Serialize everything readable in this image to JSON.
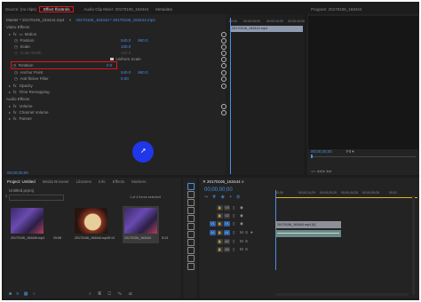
{
  "top_tabs": {
    "source": "Source: (no clips)",
    "effect_controls": "Effect Controls",
    "audio_mixer": "Audio Clip Mixer: 20170106_163444",
    "metadata": "Metadata"
  },
  "effect_controls": {
    "master": "Master * 20170106_163444.mp4",
    "sequence_clip": "20170106_163444 * 20170106_163444.mp4",
    "ruler_ticks": [
      "00:00",
      "00:00:05:00",
      "00:00:10:00",
      "00:00:15:00"
    ],
    "clip_bar_label": "20170106_163444.mp4",
    "video_effects_label": "Video Effects",
    "motion_label": "Motion",
    "position_label": "Position",
    "position_x": "540.0",
    "position_y": "960.0",
    "scale_label": "Scale",
    "scale_value": "100.0",
    "scale_width_label": "Scale Width",
    "scale_width_value": "100.0",
    "uniform_scale_label": "Uniform Scale",
    "rotation_label": "Rotation",
    "rotation_value": "0.0",
    "anchor_label": "Anchor Point",
    "anchor_x": "540.0",
    "anchor_y": "960.0",
    "antiflicker_label": "Anti-flicker Filter",
    "antiflicker_value": "0.00",
    "opacity_label": "Opacity",
    "time_remap_label": "Time Remapping",
    "audio_effects_label": "Audio Effects",
    "volume_label": "Volume",
    "channel_volume_label": "Channel Volume",
    "panner_label": "Panner",
    "timecode": "00;00;00;00"
  },
  "program": {
    "title": "Program: 20170106_163444",
    "timecode": "00;00;00;00",
    "fit_label": "Fit"
  },
  "project": {
    "tabs": [
      "Project: Untitled",
      "Media Browser",
      "Libraries",
      "Info",
      "Effects",
      "Markers"
    ],
    "project_file": "Untitled.prproj",
    "selection_info": "1 of 4 items selected",
    "items": [
      {
        "name": "20170106_163449.mp4",
        "duration": "29:08"
      },
      {
        "name": "20170106_163444.mp4",
        "duration": "5:13"
      },
      {
        "name": "20170106_163444",
        "duration": "5:13"
      }
    ]
  },
  "timeline": {
    "sequence_name": "20170106_163444",
    "timecode": "00;00;00;00",
    "ruler_ticks": [
      "00;00",
      "00;00;14;29",
      "00;00;29;29",
      "00;00;44;28",
      "00;00;59;28",
      "00;01"
    ],
    "tracks": [
      {
        "id": "V3"
      },
      {
        "id": "V2"
      },
      {
        "id": "V1",
        "clip": "20170106_163444.mp4 [V]"
      },
      {
        "id": "A1"
      },
      {
        "id": "A2"
      },
      {
        "id": "A3"
      }
    ]
  },
  "colors": {
    "highlight": "#e0151b",
    "accent_blue": "#4a8fe0",
    "clip_video": "#8f8f9a",
    "clip_audio": "#6a8a88",
    "cursor_circle": "#1f37e8"
  }
}
